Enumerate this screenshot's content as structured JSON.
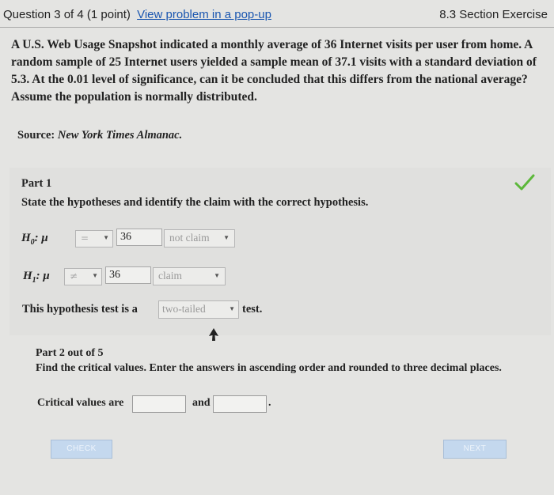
{
  "header": {
    "question_label": "Question 3 of 4 (1 point)",
    "popup_link": "View problem in a pop-up",
    "section_title": "8.3 Section Exercise"
  },
  "problem": {
    "text": "A U.S. Web Usage Snapshot indicated a monthly average of 36 Internet visits per user from home. A random sample of 25 Internet users yielded a sample mean of 37.1 visits with a standard deviation of 5.3. At the 0.01 level of significance, can it be concluded that this differs from the national average? Assume the population is normally distributed.",
    "source_label": "Source:",
    "source_name": "New York Times Almanac."
  },
  "part1": {
    "title": "Part 1",
    "instruction": "State the hypotheses and identify the claim with the correct hypothesis.",
    "status_icon": "checkmark-icon",
    "h0": {
      "label": "H",
      "sub": "0",
      "param": ": μ",
      "operator": "=",
      "value": "36",
      "claim": "not claim"
    },
    "h1": {
      "label": "H",
      "sub": "1",
      "param": ": μ",
      "operator": "≠",
      "value": "36",
      "claim": "claim"
    },
    "tail_prefix": "This hypothesis test is a",
    "tail_value": "two-tailed",
    "tail_suffix": "test."
  },
  "part2": {
    "title": "Part 2 out of 5",
    "instruction": "Find the critical values. Enter the answers in ascending order and rounded to three decimal places.",
    "critical_label": "Critical values are",
    "and_label": "and",
    "period": ".",
    "value1": "",
    "value2": ""
  },
  "buttons": {
    "check": "CHECK",
    "next": "NEXT"
  },
  "colors": {
    "link": "#1a56b0",
    "check": "#5cb83a",
    "button": "#c4d8ee"
  }
}
